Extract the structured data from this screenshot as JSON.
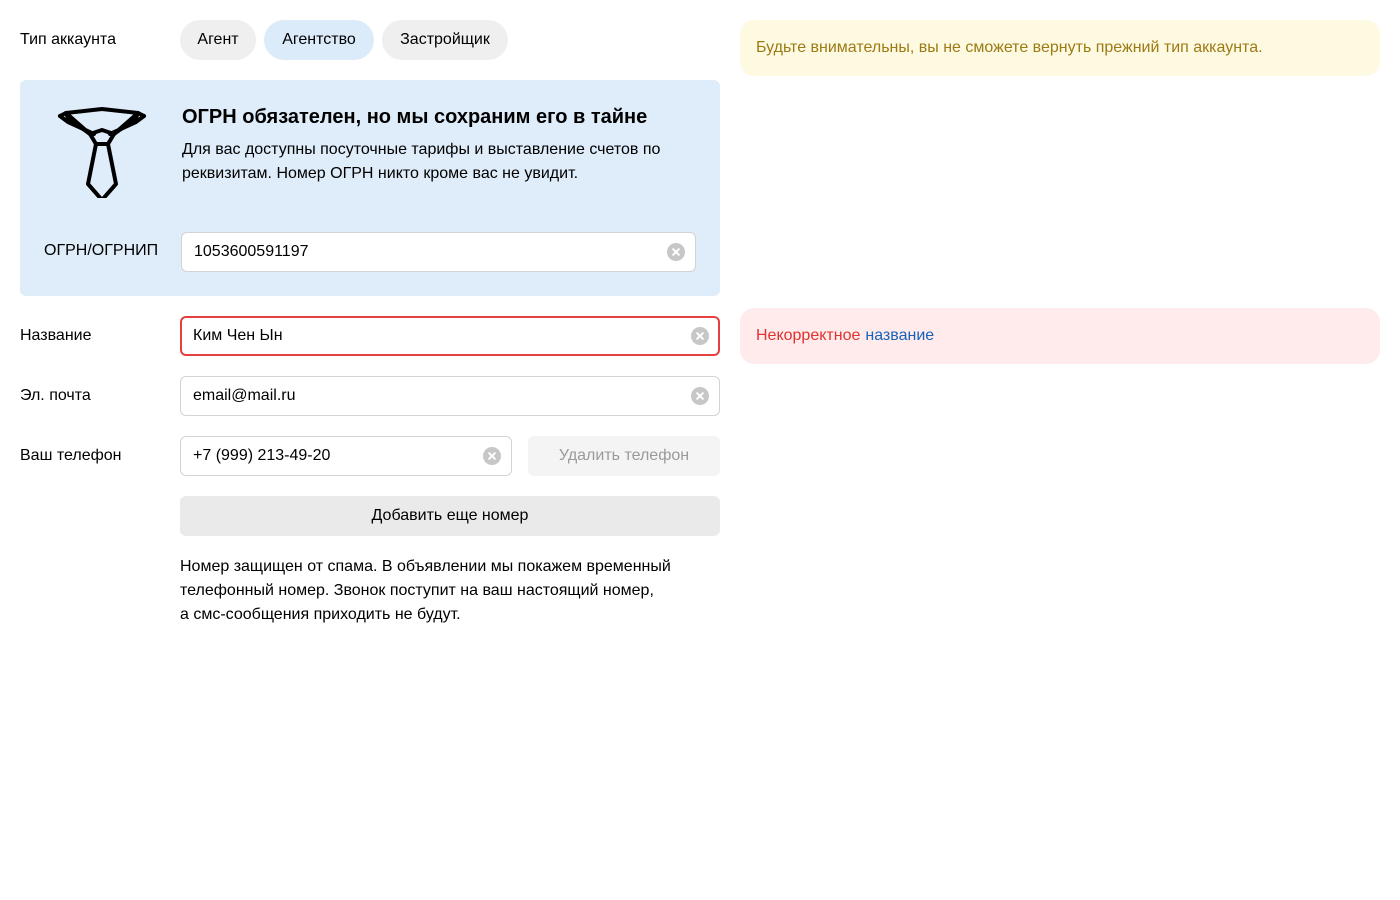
{
  "account_type": {
    "label": "Тип аккаунта",
    "options": [
      "Агент",
      "Агентство",
      "Застройщик"
    ],
    "selected": "Агентство"
  },
  "warning": {
    "text": "Будьте внимательны, вы не сможете вернуть прежний тип аккаунта."
  },
  "promo": {
    "icon": "tie-icon",
    "title": "ОГРН обязателен, но мы сохраним его в тайне",
    "text": "Для вас доступны посуточные тарифы и выставление счетов по реквизитам. Номер ОГРН никто кроме вас не увидит.",
    "ogrn_label": "ОГРН/ОГРНИП",
    "ogrn_value": "1053600591197"
  },
  "name": {
    "label": "Название",
    "value": "Ким Чен Ын"
  },
  "name_error": {
    "text": "Некорректное",
    "link": "название"
  },
  "email": {
    "label": "Эл. почта",
    "value": "email@mail.ru"
  },
  "phone": {
    "label": "Ваш телефон",
    "value": "+7 (999) 213-49-20",
    "delete_label": "Удалить телефон",
    "add_label": "Добавить еще номер"
  },
  "hint": {
    "lines": [
      "Номер защищен от спама. В объявлении мы покажем временный",
      "телефонный номер. Звонок поступит на ваш настоящий номер,",
      "а смс-сообщения приходить не будут."
    ]
  },
  "colors": {
    "selected_pill": "#dcebfa",
    "promo_bg": "#dfecf9",
    "warning_bg": "#fef9e1",
    "warning_text": "#9c7a14",
    "error_bg": "#ffebeb",
    "error_text": "#e0322f",
    "error_border": "#e4403d",
    "link": "#1a62b7"
  }
}
